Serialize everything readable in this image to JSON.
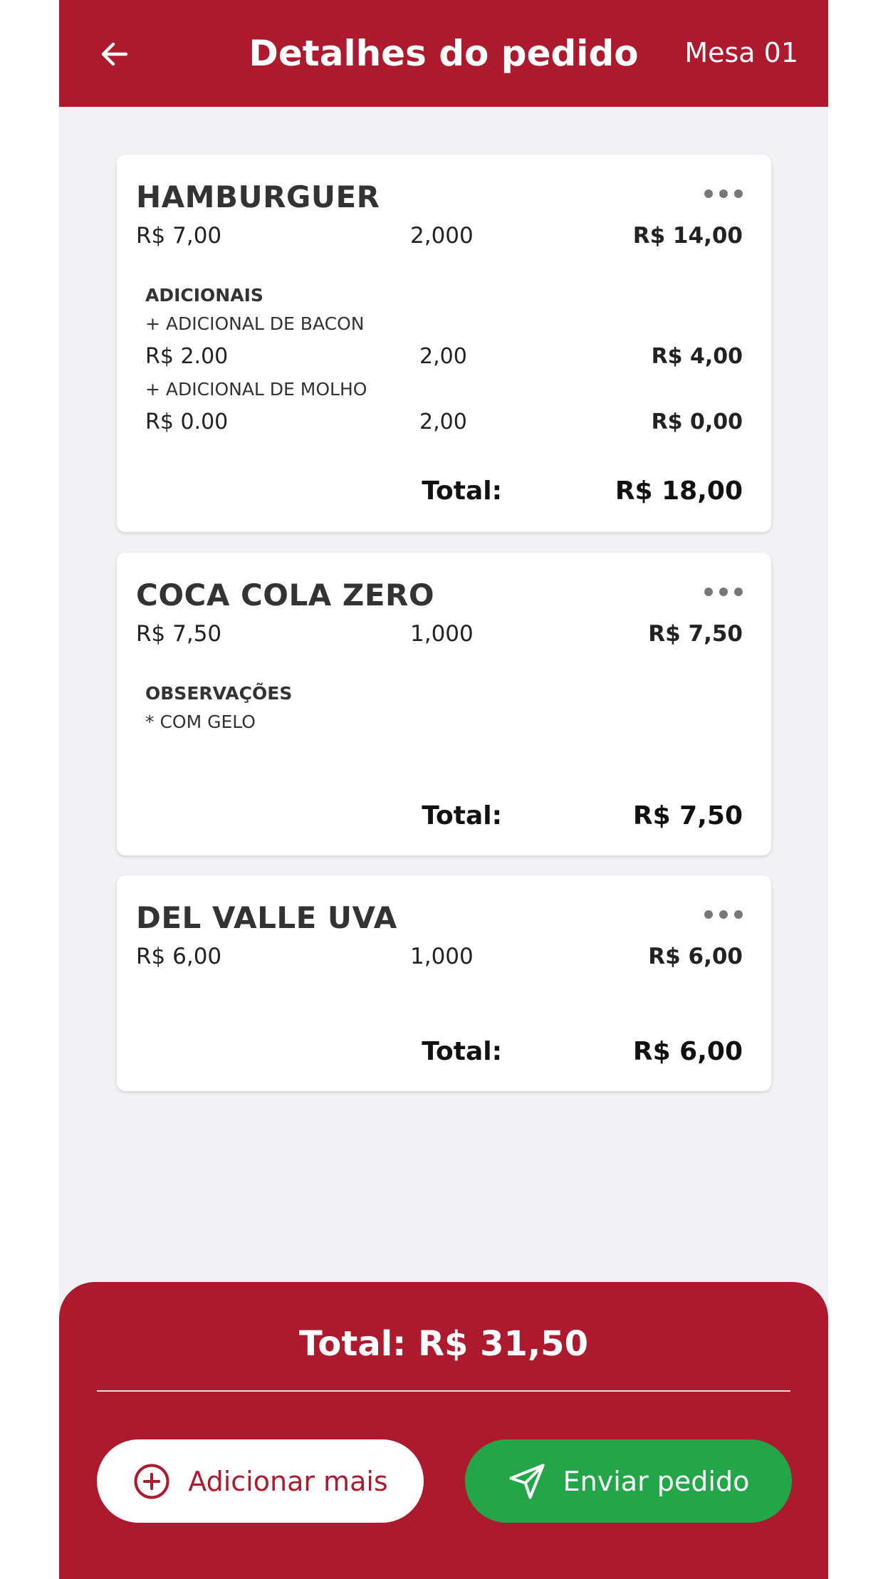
{
  "header": {
    "title": "Detalhes do pedido",
    "table": "Mesa 01"
  },
  "items": [
    {
      "name": "HAMBURGUER",
      "unit_price": "R$ 7,00",
      "qty": "2,000",
      "subtotal": "R$ 14,00",
      "extras_label": "ADICIONAIS",
      "extras": [
        {
          "name": "+ ADICIONAL DE BACON",
          "price": "R$ 2.00",
          "qty": "2,00",
          "total": "R$ 4,00"
        },
        {
          "name": "+ ADICIONAL DE MOLHO",
          "price": "R$ 0.00",
          "qty": "2,00",
          "total": "R$ 0,00"
        }
      ],
      "total_label": "Total:",
      "total": "R$ 18,00"
    },
    {
      "name": "COCA COLA ZERO",
      "unit_price": "R$ 7,50",
      "qty": "1,000",
      "subtotal": "R$ 7,50",
      "notes_label": "OBSERVAÇÕES",
      "notes": [
        "* COM GELO"
      ],
      "total_label": "Total:",
      "total": "R$ 7,50"
    },
    {
      "name": "DEL VALLE UVA",
      "unit_price": "R$ 6,00",
      "qty": "1,000",
      "subtotal": "R$ 6,00",
      "total_label": "Total:",
      "total": "R$ 6,00"
    }
  ],
  "footer": {
    "grand_total": "Total: R$ 31,50",
    "add_more_label": "Adicionar mais",
    "send_label": "Enviar pedido"
  },
  "colors": {
    "brand": "#ad1a2d",
    "success": "#22a648",
    "background": "#f2f1f5"
  },
  "icons": {
    "back": "arrow-left-icon",
    "more": "more-horizontal-icon",
    "add": "plus-circle-icon",
    "send": "send-icon"
  }
}
